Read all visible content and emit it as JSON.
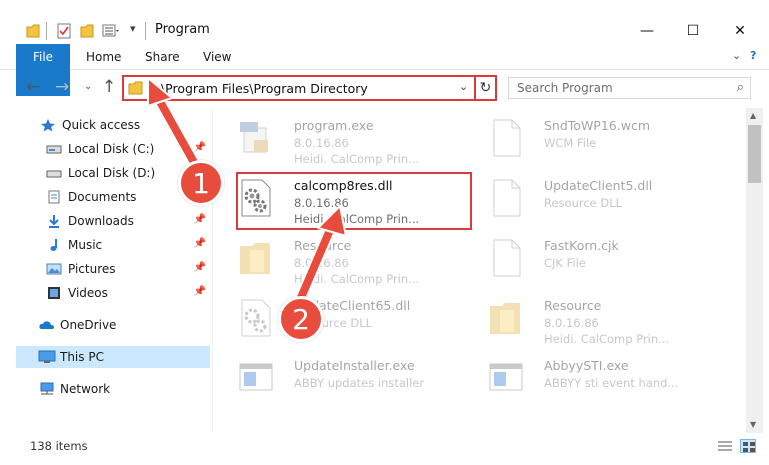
{
  "window": {
    "title": "Program",
    "controls": {
      "minimize": "—",
      "maximize": "☐",
      "close": "✕"
    }
  },
  "ribbon": {
    "tabs": [
      "File",
      "Home",
      "Share",
      "View"
    ]
  },
  "address": {
    "path": "C:\\Program Files\\Program Directory",
    "search_placeholder": "Search Program"
  },
  "sidebar": {
    "items": [
      {
        "label": "Quick access",
        "icon": "star-icon",
        "pinned": false
      },
      {
        "label": "Local Disk (C:)",
        "icon": "drive-icon",
        "pinned": true
      },
      {
        "label": "Local Disk (D:)",
        "icon": "drive-icon",
        "pinned": false
      },
      {
        "label": "Documents",
        "icon": "documents-icon",
        "pinned": true
      },
      {
        "label": "Downloads",
        "icon": "download-icon",
        "pinned": true
      },
      {
        "label": "Music",
        "icon": "music-icon",
        "pinned": true
      },
      {
        "label": "Pictures",
        "icon": "pictures-icon",
        "pinned": true
      },
      {
        "label": "Videos",
        "icon": "videos-icon",
        "pinned": true
      },
      {
        "label": "OneDrive",
        "icon": "cloud-icon",
        "pinned": false
      },
      {
        "label": "This PC",
        "icon": "computer-icon",
        "pinned": false,
        "selected": true
      },
      {
        "label": "Network",
        "icon": "network-icon",
        "pinned": false
      }
    ],
    "pin_glyph": "📌"
  },
  "files": [
    {
      "name": "program.exe",
      "version": "8.0.16.86",
      "desc": "Heidi. CalComp Prin...",
      "icon": "exe-icon"
    },
    {
      "name": "SndToWP16.wcm",
      "version": "WCM File",
      "desc": "",
      "icon": "file-icon"
    },
    {
      "name": "calcomp8res.dll",
      "version": "8.0.16.86",
      "desc": "Heidi. CalComp Prin...",
      "icon": "dll-gear-icon"
    },
    {
      "name": "UpdateClient5.dll",
      "version": "Resource DLL",
      "desc": "",
      "icon": "file-icon"
    },
    {
      "name": "Resource",
      "version": "8.0.16.86",
      "desc": "Heidi. CalComp Prin...",
      "icon": "folder-icon"
    },
    {
      "name": "FastKorn.cjk",
      "version": "CJK File",
      "desc": "",
      "icon": "file-icon"
    },
    {
      "name": "UpdateClient65.dll",
      "version": "Resource DLL",
      "desc": "",
      "icon": "dll-gear-icon"
    },
    {
      "name": "Resource",
      "version": "8.0.16.86",
      "desc": "Heidi. CalComp Prin...",
      "icon": "folder-icon"
    },
    {
      "name": "UpdateInstaller.exe",
      "version": "ABBY updates installer",
      "desc": "",
      "icon": "installer-icon"
    },
    {
      "name": "AbbyySTI.exe",
      "version": "ABBYY sti event hand...",
      "desc": "",
      "icon": "installer-icon"
    }
  ],
  "status": {
    "count": "138 items"
  },
  "annotations": {
    "step1": "1",
    "step2": "2"
  },
  "colors": {
    "accent": "#1979ca",
    "highlight": "#d93a3a",
    "bubble": "#e74c3c",
    "selected": "#cce8ff"
  }
}
